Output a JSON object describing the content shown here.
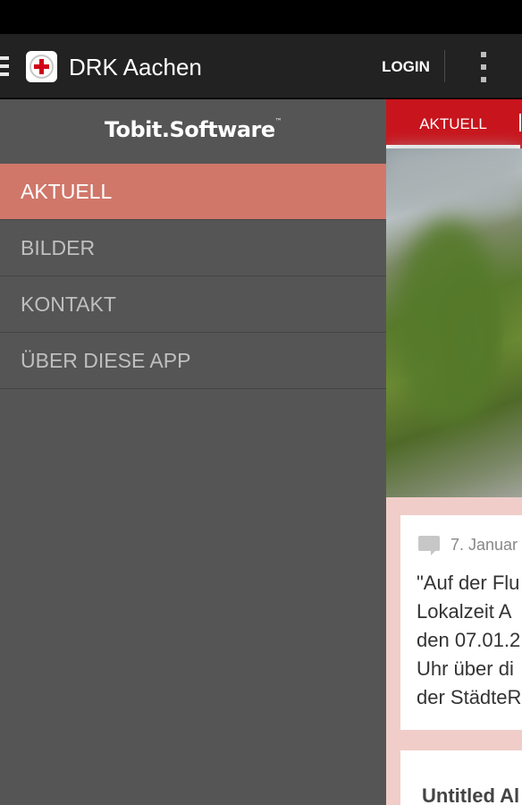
{
  "action_bar": {
    "app_title": "DRK Aachen",
    "login_label": "LOGIN",
    "icons": [
      "menu-icon",
      "drk-logo-icon",
      "overflow-menu-icon"
    ]
  },
  "drawer": {
    "header_logo_text": "Tobit.Software",
    "header_logo_tm": "™",
    "items": [
      {
        "label": "AKTUELL",
        "active": true
      },
      {
        "label": "BILDER",
        "active": false
      },
      {
        "label": "KONTAKT",
        "active": false
      },
      {
        "label": "ÜBER DIESE APP",
        "active": false
      }
    ]
  },
  "content": {
    "tabs": [
      {
        "label": "AKTUELL",
        "active": true
      }
    ],
    "cards": [
      {
        "date": "7. Januar",
        "lines": [
          "\"Auf der Flu",
          "Lokalzeit A",
          "den 07.01.2",
          "Uhr über di",
          "der StädteR"
        ]
      },
      {
        "title": "Untitled Al"
      }
    ]
  },
  "colors": {
    "action_bar": "#222222",
    "drawer_bg": "#555555",
    "drawer_active": "#d0776a",
    "tab_bar": "#c8141c",
    "content_bg": "#f0cdc9"
  }
}
